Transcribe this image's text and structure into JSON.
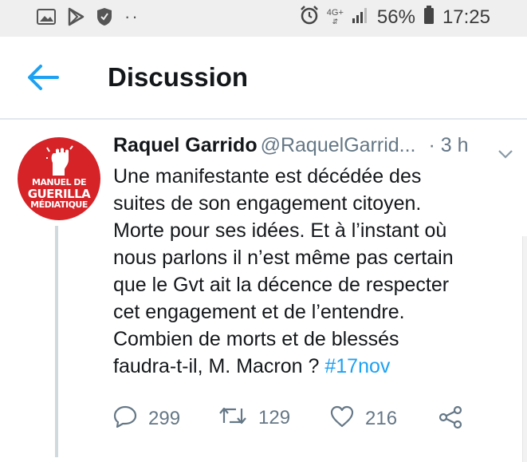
{
  "status_bar": {
    "network": "4G+",
    "battery": "56%",
    "time": "17:25",
    "icons": [
      "gallery-icon",
      "play-store-icon",
      "shield-icon",
      "more-dots-icon",
      "alarm-icon",
      "signal-icon",
      "battery-icon"
    ]
  },
  "header": {
    "title": "Discussion",
    "back_icon": "back-arrow-icon"
  },
  "tweet": {
    "avatar_text": [
      "MANUEL DE",
      "GUERILLA",
      "MÉDIATIQUE"
    ],
    "name": "Raquel Garrido",
    "handle": "@RaquelGarrid...",
    "time": "· 3 h",
    "text_lines": [
      "Une manifestante est décédée des",
      "suites de son engagement citoyen.",
      "Morte pour ses idées. Et à l’instant où",
      "nous parlons il n’est même pas certain",
      "que le Gvt ait la décence de respecter",
      "cet engagement et de l’entendre.",
      "Combien de morts et de blessés",
      "faudra-t-il, M. Macron ?"
    ],
    "hashtag": "#17nov",
    "actions": {
      "replies": "299",
      "retweets": "129",
      "likes": "216"
    }
  },
  "colors": {
    "accent": "#1da1f2",
    "secondary_text": "#657786",
    "avatar_red": "#d62328"
  }
}
